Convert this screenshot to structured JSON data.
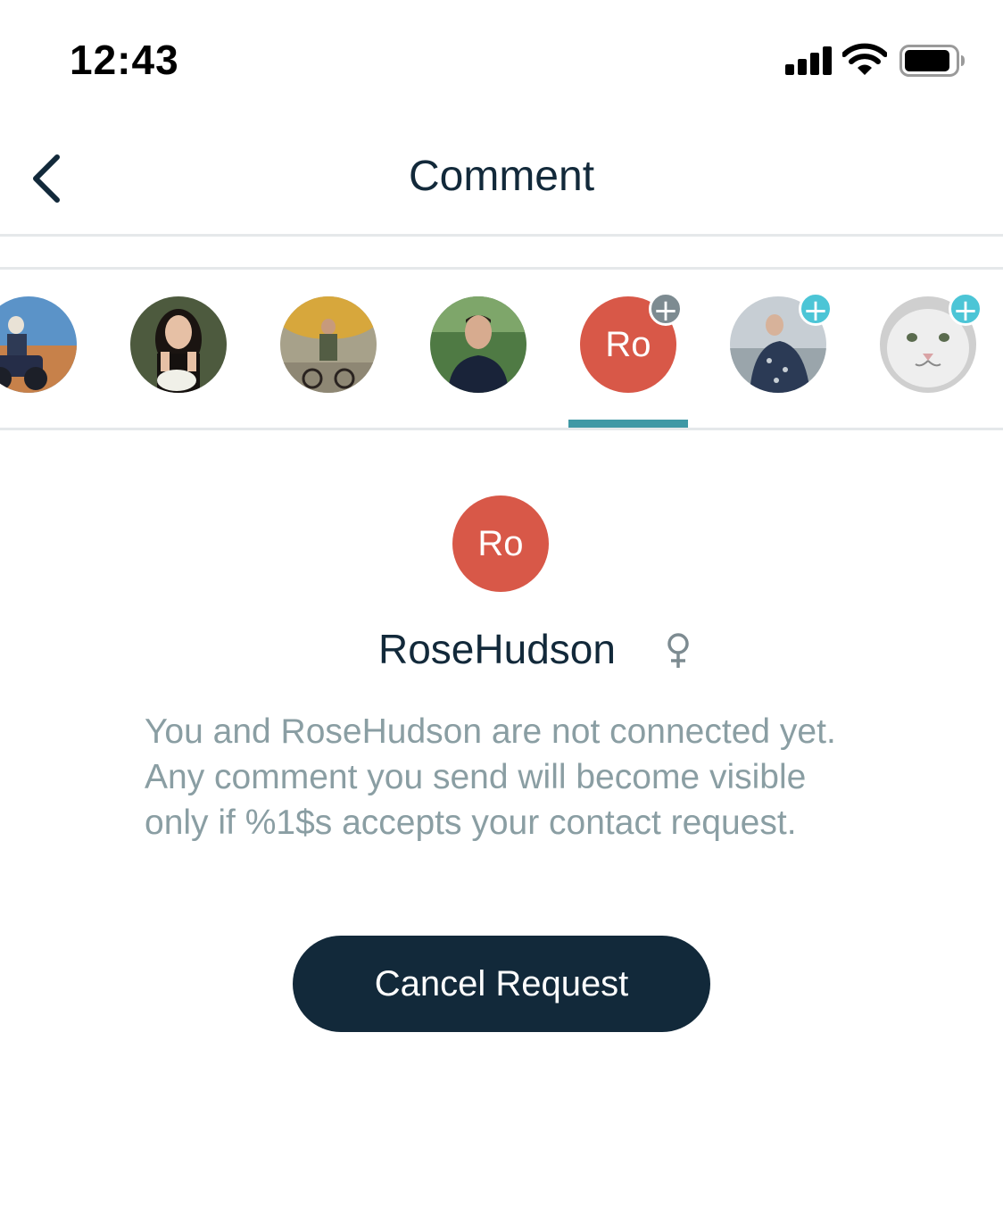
{
  "status_bar": {
    "time": "12:43",
    "signal_icon": "cellular-signal-icon",
    "wifi_icon": "wifi-icon",
    "battery_icon": "battery-icon"
  },
  "header": {
    "back_icon": "chevron-left-icon",
    "title": "Comment"
  },
  "avatar_strip": {
    "items": [
      {
        "type": "photo",
        "badge": null
      },
      {
        "type": "photo",
        "badge": null
      },
      {
        "type": "photo",
        "badge": null
      },
      {
        "type": "photo",
        "badge": null
      },
      {
        "type": "initials",
        "initials": "Ro",
        "badge": "+",
        "badge_color": "#7d8b91",
        "selected": true
      },
      {
        "type": "photo",
        "badge": "+",
        "badge_color": "#4cc5d6"
      },
      {
        "type": "photo",
        "badge": "+",
        "badge_color": "#4cc5d6"
      }
    ]
  },
  "profile": {
    "initials": "Ro",
    "name": "RoseHudson",
    "gender_icon": "female-icon",
    "message": "You and RoseHudson are not connected yet. Any comment you send will become visible only if %1$s accepts your contact request."
  },
  "actions": {
    "cancel_request_label": "Cancel Request"
  },
  "colors": {
    "accent": "#3f98a5",
    "avatar_red": "#d85848",
    "primary_dark": "#12293a",
    "muted_text": "#8a9ea3",
    "badge_teal": "#4cc5d6",
    "badge_grey": "#7d8b91"
  }
}
